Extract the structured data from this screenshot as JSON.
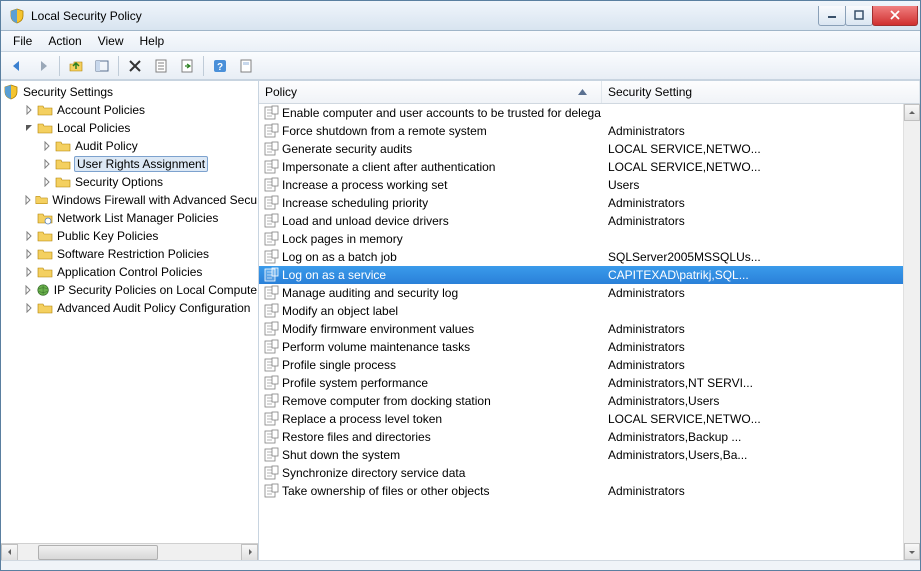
{
  "window": {
    "title": "Local Security Policy"
  },
  "menu": {
    "items": [
      "File",
      "Action",
      "View",
      "Help"
    ]
  },
  "tree": {
    "root": {
      "label": "Security Settings",
      "icon": "shield"
    },
    "nodes": [
      {
        "label": "Account Policies",
        "depth": 1,
        "expander": "closed",
        "icon": "folder"
      },
      {
        "label": "Local Policies",
        "depth": 1,
        "expander": "open",
        "icon": "folder"
      },
      {
        "label": "Audit Policy",
        "depth": 2,
        "expander": "closed",
        "icon": "folder"
      },
      {
        "label": "User Rights Assignment",
        "depth": 2,
        "expander": "closed",
        "icon": "folder",
        "selected": true
      },
      {
        "label": "Security Options",
        "depth": 2,
        "expander": "closed",
        "icon": "folder"
      },
      {
        "label": "Windows Firewall with Advanced Secu",
        "depth": 1,
        "expander": "closed",
        "icon": "folder"
      },
      {
        "label": "Network List Manager Policies",
        "depth": 1,
        "expander": "none",
        "icon": "folder-net"
      },
      {
        "label": "Public Key Policies",
        "depth": 1,
        "expander": "closed",
        "icon": "folder"
      },
      {
        "label": "Software Restriction Policies",
        "depth": 1,
        "expander": "closed",
        "icon": "folder"
      },
      {
        "label": "Application Control Policies",
        "depth": 1,
        "expander": "closed",
        "icon": "folder"
      },
      {
        "label": "IP Security Policies on Local Compute",
        "depth": 1,
        "expander": "closed",
        "icon": "globe"
      },
      {
        "label": "Advanced Audit Policy Configuration",
        "depth": 1,
        "expander": "closed",
        "icon": "folder"
      }
    ]
  },
  "list": {
    "columns": {
      "policy": "Policy",
      "setting": "Security Setting"
    },
    "rows": [
      {
        "policy": "Enable computer and user accounts to be trusted for delega...",
        "setting": ""
      },
      {
        "policy": "Force shutdown from a remote system",
        "setting": "Administrators"
      },
      {
        "policy": "Generate security audits",
        "setting": "LOCAL SERVICE,NETWO..."
      },
      {
        "policy": "Impersonate a client after authentication",
        "setting": "LOCAL SERVICE,NETWO..."
      },
      {
        "policy": "Increase a process working set",
        "setting": "Users"
      },
      {
        "policy": "Increase scheduling priority",
        "setting": "Administrators"
      },
      {
        "policy": "Load and unload device drivers",
        "setting": "Administrators"
      },
      {
        "policy": "Lock pages in memory",
        "setting": ""
      },
      {
        "policy": "Log on as a batch job",
        "setting": "SQLServer2005MSSQLUs..."
      },
      {
        "policy": "Log on as a service",
        "setting": "CAPITEXAD\\patrikj,SQL...",
        "selected": true
      },
      {
        "policy": "Manage auditing and security log",
        "setting": "Administrators"
      },
      {
        "policy": "Modify an object label",
        "setting": ""
      },
      {
        "policy": "Modify firmware environment values",
        "setting": "Administrators"
      },
      {
        "policy": "Perform volume maintenance tasks",
        "setting": "Administrators"
      },
      {
        "policy": "Profile single process",
        "setting": "Administrators"
      },
      {
        "policy": "Profile system performance",
        "setting": "Administrators,NT SERVI..."
      },
      {
        "policy": "Remove computer from docking station",
        "setting": "Administrators,Users"
      },
      {
        "policy": "Replace a process level token",
        "setting": "LOCAL SERVICE,NETWO..."
      },
      {
        "policy": "Restore files and directories",
        "setting": "Administrators,Backup ..."
      },
      {
        "policy": "Shut down the system",
        "setting": "Administrators,Users,Ba..."
      },
      {
        "policy": "Synchronize directory service data",
        "setting": ""
      },
      {
        "policy": "Take ownership of files or other objects",
        "setting": "Administrators"
      }
    ]
  }
}
